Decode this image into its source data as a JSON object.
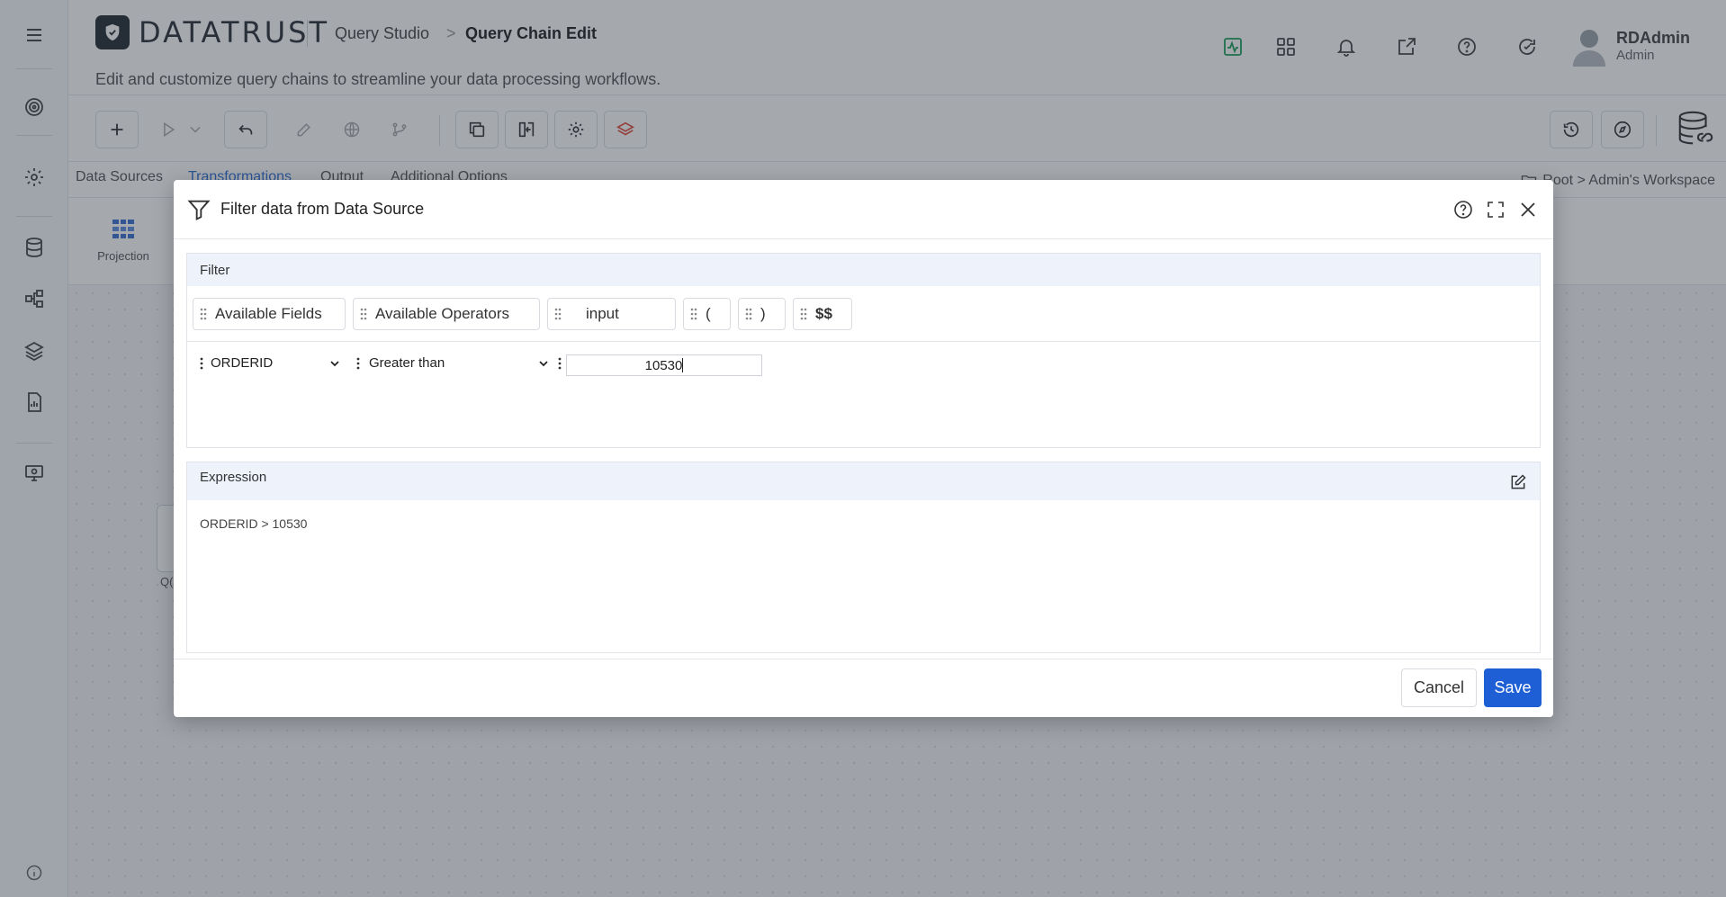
{
  "app": {
    "logo_text": "DATATRUST",
    "breadcrumb": {
      "parent": "Query Studio",
      "separator": ">",
      "current": "Query Chain Edit"
    },
    "subtitle": "Edit and customize query chains to streamline your data processing workflows.",
    "user": {
      "name": "RDAdmin",
      "role": "Admin"
    }
  },
  "header_icons": [
    "activity-icon",
    "apps-grid-icon",
    "bell-icon",
    "external-link-icon",
    "help-icon",
    "refresh-icon"
  ],
  "sidebar_icons": [
    "menu-icon",
    "target-icon",
    "settings-icon",
    "database-icon",
    "workflow-icon",
    "layers-icon",
    "report-icon",
    "monitor-icon",
    "info-icon"
  ],
  "tabs": [
    {
      "label": "Data Sources",
      "active": false
    },
    {
      "label": "Transformations",
      "active": true
    },
    {
      "label": "Output",
      "active": false
    },
    {
      "label": "Additional Options",
      "active": false
    }
  ],
  "workspace_path": "Root > Admin's Workspace",
  "transform_panel": {
    "projection_label": "Projection"
  },
  "canvas": {
    "node_label": "Q("
  },
  "modal": {
    "title": "Filter data from Data Source",
    "filter": {
      "section_title": "Filter",
      "chips": [
        "Available Fields",
        "Available Operators",
        "input",
        "(",
        ")",
        "$$"
      ],
      "condition": {
        "field": "ORDERID",
        "operator": "Greater than",
        "value": "10530"
      }
    },
    "expression": {
      "section_title": "Expression",
      "text": "ORDERID > 10530"
    },
    "buttons": {
      "cancel": "Cancel",
      "save": "Save"
    }
  },
  "colors": {
    "primary": "#1f5fd6",
    "section_header_bg": "#edf2fb",
    "activity_icon": "#1a9e5a",
    "stack_icon": "#e04b3c",
    "active_tab": "#2f6fd6"
  }
}
